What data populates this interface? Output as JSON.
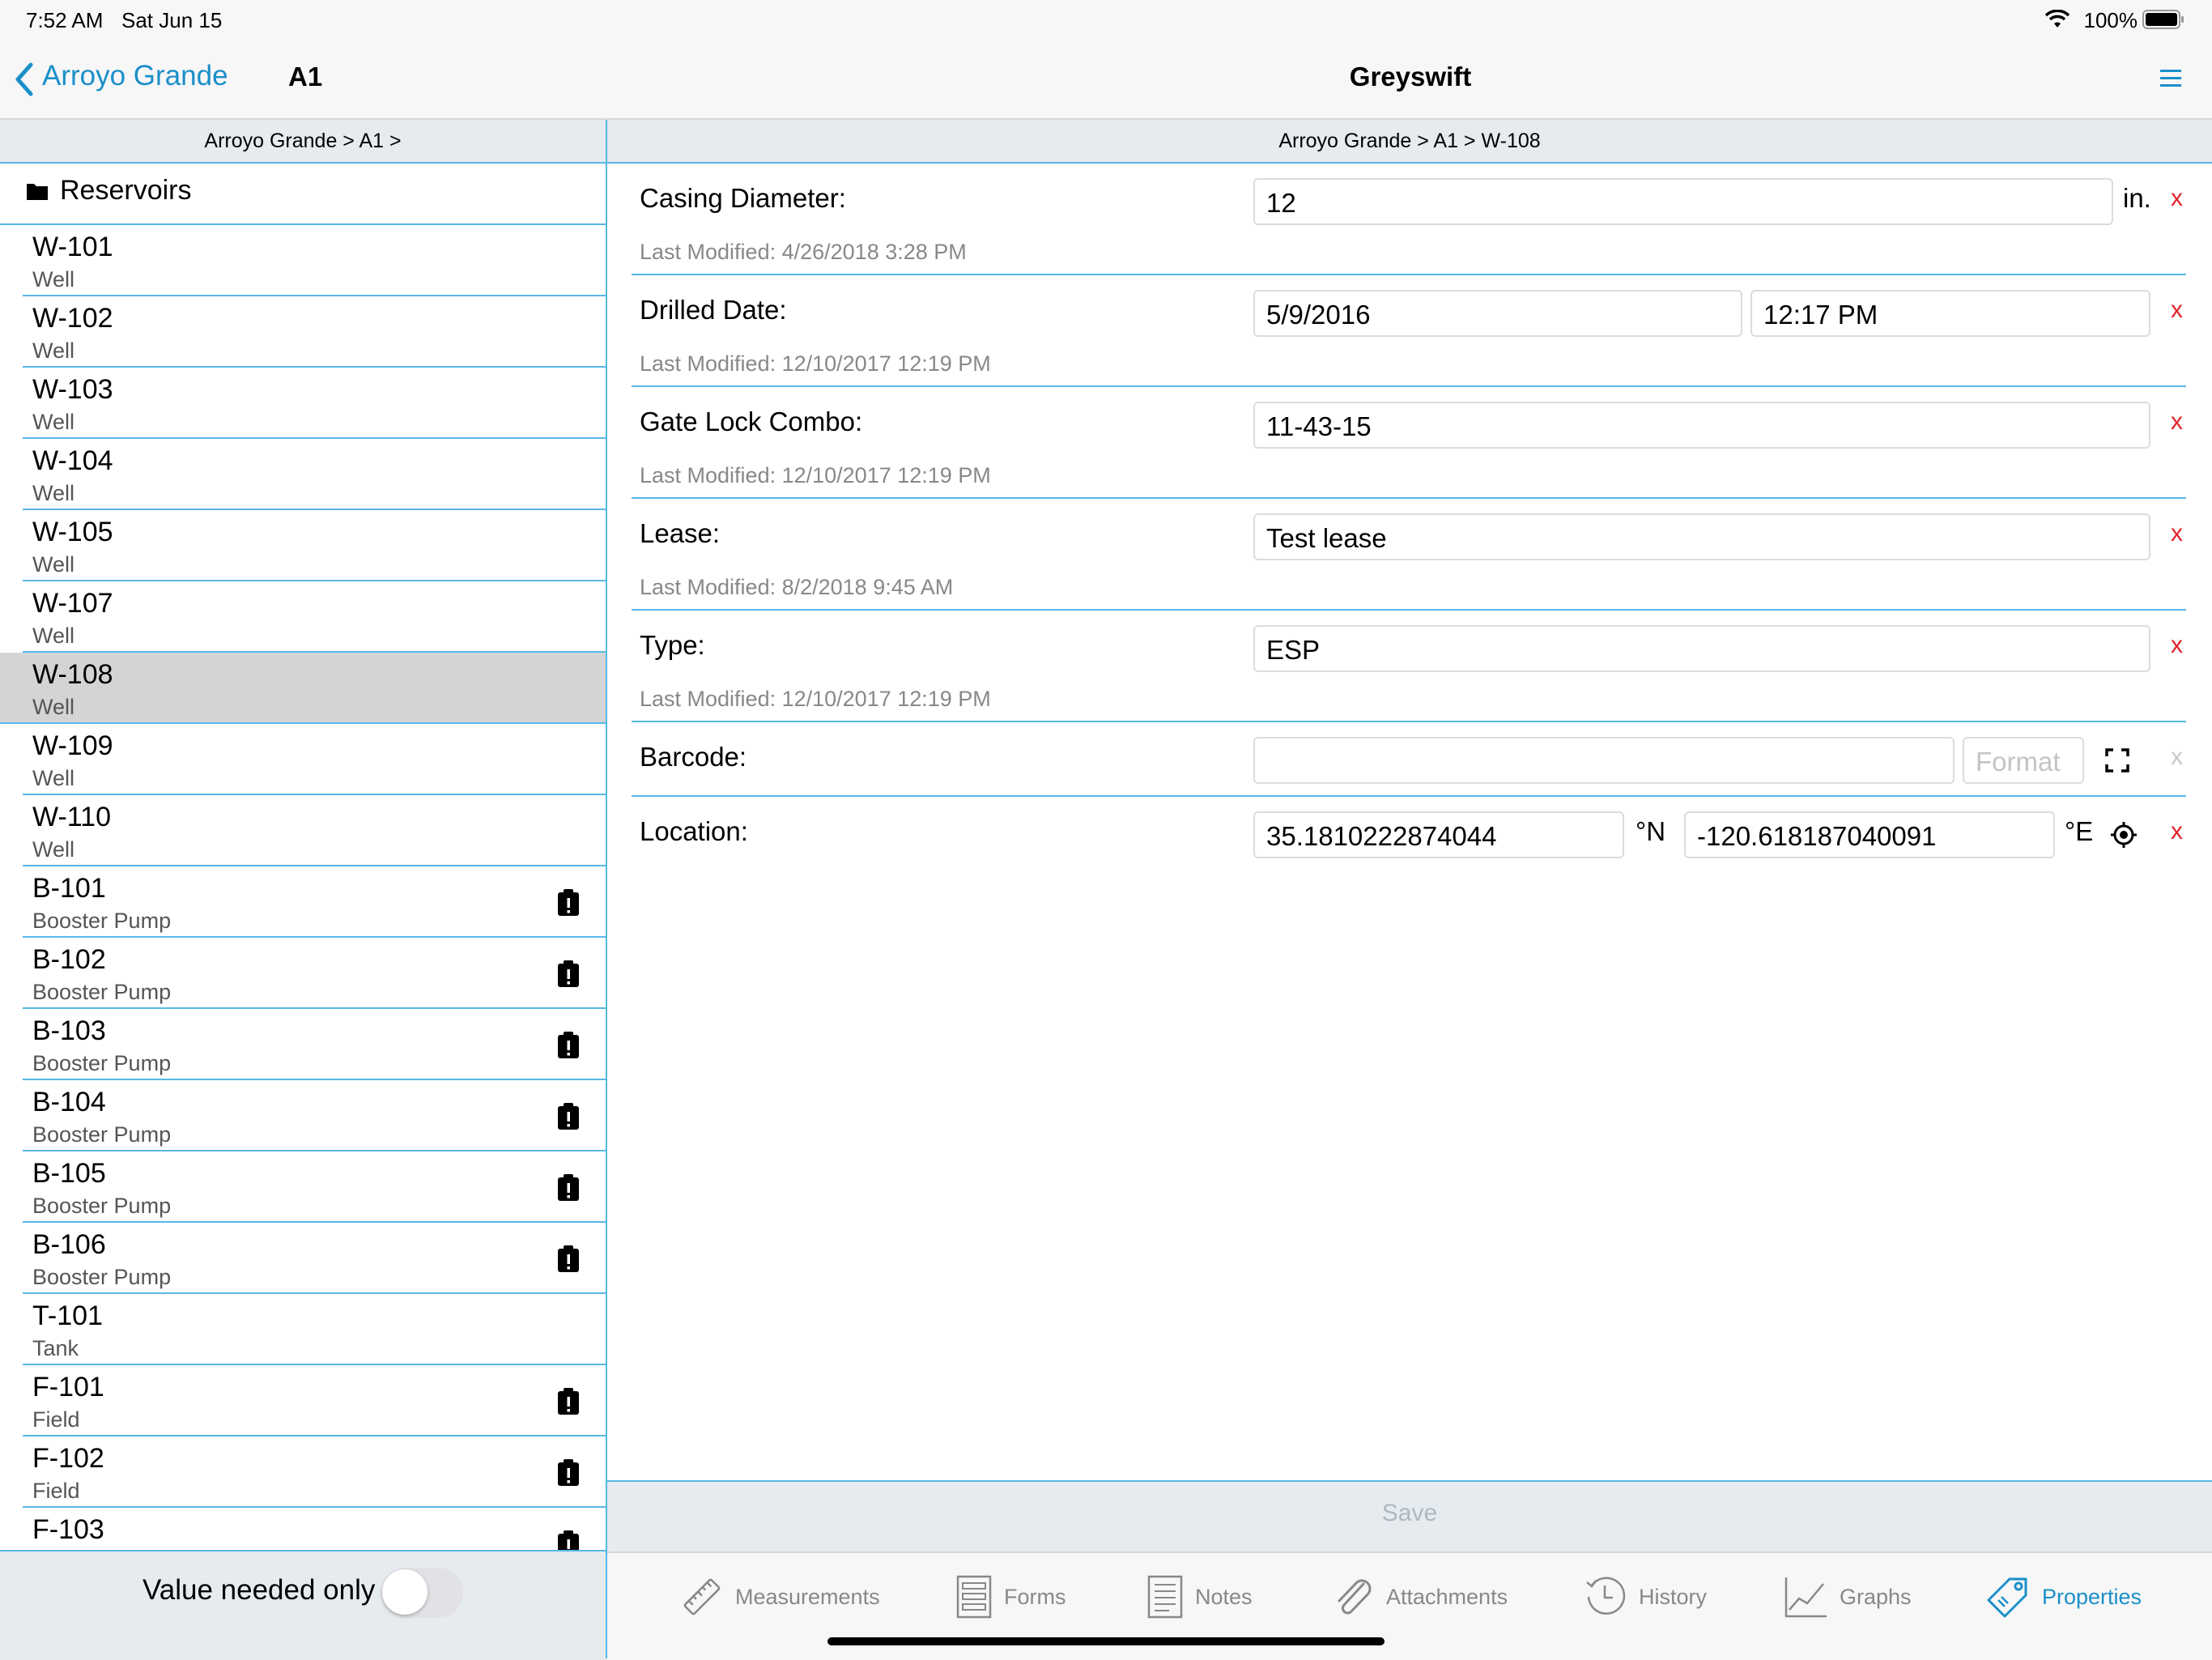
{
  "status": {
    "time": "7:52 AM",
    "date": "Sat Jun 15",
    "battery": "100%"
  },
  "nav": {
    "back_label": "Arroyo Grande",
    "left_title": "A1",
    "main_title": "Greyswift"
  },
  "breadcrumbs": {
    "left": "Arroyo Grande > A1 >",
    "right": "Arroyo Grande > A1 > W-108"
  },
  "sidebar": {
    "group": "Reservoirs",
    "items": [
      {
        "name": "W-101",
        "type": "Well",
        "badge": false
      },
      {
        "name": "W-102",
        "type": "Well",
        "badge": false
      },
      {
        "name": "W-103",
        "type": "Well",
        "badge": false
      },
      {
        "name": "W-104",
        "type": "Well",
        "badge": false
      },
      {
        "name": "W-105",
        "type": "Well",
        "badge": false
      },
      {
        "name": "W-107",
        "type": "Well",
        "badge": false
      },
      {
        "name": "W-108",
        "type": "Well",
        "badge": false,
        "selected": true
      },
      {
        "name": "W-109",
        "type": "Well",
        "badge": false
      },
      {
        "name": "W-110",
        "type": "Well",
        "badge": false
      },
      {
        "name": "B-101",
        "type": "Booster Pump",
        "badge": true
      },
      {
        "name": "B-102",
        "type": "Booster Pump",
        "badge": true
      },
      {
        "name": "B-103",
        "type": "Booster Pump",
        "badge": true
      },
      {
        "name": "B-104",
        "type": "Booster Pump",
        "badge": true
      },
      {
        "name": "B-105",
        "type": "Booster Pump",
        "badge": true
      },
      {
        "name": "B-106",
        "type": "Booster Pump",
        "badge": true
      },
      {
        "name": "T-101",
        "type": "Tank",
        "badge": false
      },
      {
        "name": "F-101",
        "type": "Field",
        "badge": true
      },
      {
        "name": "F-102",
        "type": "Field",
        "badge": true
      },
      {
        "name": "F-103",
        "type": "",
        "badge": true
      }
    ],
    "toggle_label": "Value needed only",
    "toggle_on": false
  },
  "properties": {
    "casing": {
      "label": "Casing Diameter:",
      "value": "12",
      "unit": "in.",
      "modified": "Last Modified: 4/26/2018 3:28 PM"
    },
    "drilled": {
      "label": "Drilled Date:",
      "date": "5/9/2016",
      "time": "12:17 PM",
      "modified": "Last Modified: 12/10/2017 12:19 PM"
    },
    "gate": {
      "label": "Gate Lock Combo:",
      "value": "11-43-15",
      "modified": "Last Modified: 12/10/2017 12:19 PM"
    },
    "lease": {
      "label": "Lease:",
      "value": "Test lease",
      "modified": "Last Modified: 8/2/2018 9:45 AM"
    },
    "type": {
      "label": "Type:",
      "value": "ESP",
      "modified": "Last Modified: 12/10/2017 12:19 PM"
    },
    "barcode": {
      "label": "Barcode:",
      "value": "",
      "format_placeholder": "Format"
    },
    "location": {
      "label": "Location:",
      "lat": "35.1810222874044",
      "lat_unit": "°N",
      "lon": "-120.618187040091",
      "lon_unit": "°E"
    },
    "clear_label": "x"
  },
  "save_label": "Save",
  "tabs": [
    {
      "label": "Measurements",
      "icon": "ruler-icon"
    },
    {
      "label": "Forms",
      "icon": "form-icon"
    },
    {
      "label": "Notes",
      "icon": "notes-icon"
    },
    {
      "label": "Attachments",
      "icon": "paperclip-icon"
    },
    {
      "label": "History",
      "icon": "clock-icon"
    },
    {
      "label": "Graphs",
      "icon": "graph-icon"
    },
    {
      "label": "Properties",
      "icon": "tag-icon",
      "active": true
    }
  ],
  "colors": {
    "accent": "#1a8fc9",
    "separator": "#58b7e6",
    "clear": "#e0222a"
  }
}
